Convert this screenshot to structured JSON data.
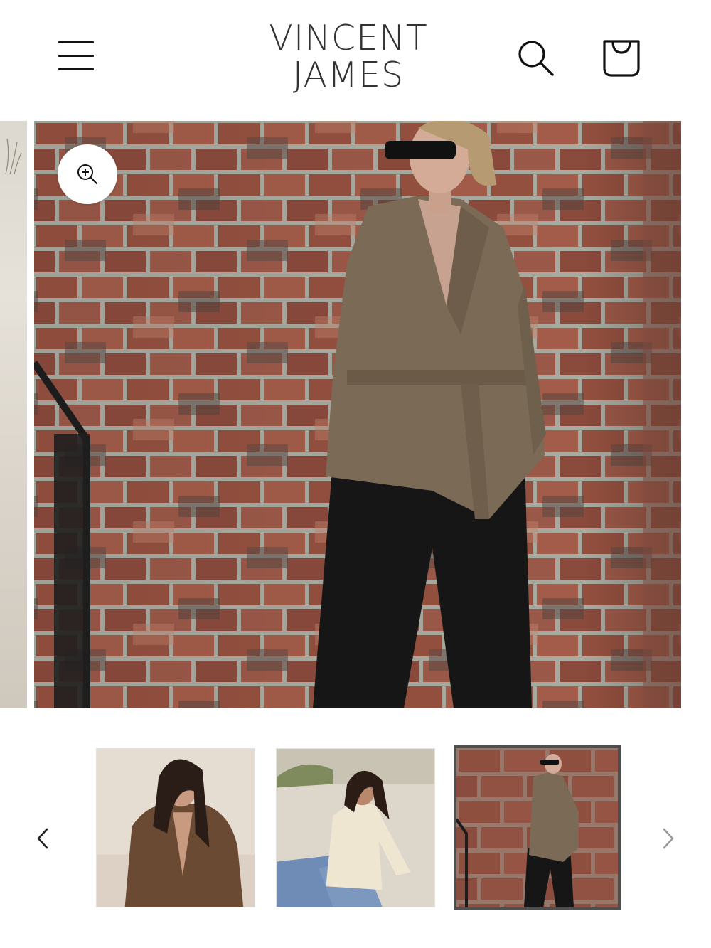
{
  "header": {
    "logo_line1": "VINCENT",
    "logo_line2": "JAMES",
    "menu_icon": "hamburger-menu-icon",
    "search_icon": "search-icon",
    "cart_icon": "shopping-bag-icon"
  },
  "gallery": {
    "zoom_icon": "zoom-in-icon",
    "prev_icon": "chevron-left-icon",
    "next_icon": "chevron-right-icon",
    "active_thumbnail_index": 3,
    "thumbnail_count": 3
  },
  "colors": {
    "text": "#121212",
    "logo": "#333333",
    "active_thumb_border": "#4f4f4f",
    "background": "#ffffff"
  }
}
